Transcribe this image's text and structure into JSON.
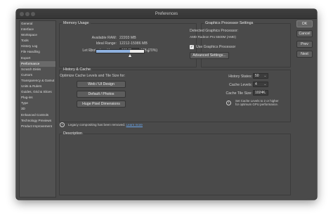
{
  "window": {
    "title": "Preferences"
  },
  "sidebar": {
    "items": [
      {
        "label": "General"
      },
      {
        "label": "Interface"
      },
      {
        "label": "Workspace"
      },
      {
        "label": "Tools"
      },
      {
        "label": "History Log"
      },
      {
        "label": "File Handling"
      },
      {
        "label": "Export"
      },
      {
        "label": "Performance"
      },
      {
        "label": "Scratch Disks"
      },
      {
        "label": "Cursors"
      },
      {
        "label": "Transparency & Gamut"
      },
      {
        "label": "Units & Rulers"
      },
      {
        "label": "Guides, Grid & Slices"
      },
      {
        "label": "Plug-ins"
      },
      {
        "label": "Type"
      },
      {
        "label": "3D"
      },
      {
        "label": "Enhanced Controls"
      },
      {
        "label": "Technology Previews"
      },
      {
        "label": "Product Improvement"
      }
    ],
    "active": "Performance"
  },
  "memory": {
    "title": "Memory Usage",
    "available_label": "Available RAM:",
    "available_value": "22203 MB",
    "ideal_label": "Ideal Range:",
    "ideal_value": "12212-15986 MB",
    "let_label": "Let Photoshop Use:",
    "let_value": "15542",
    "let_unit": "MB (70%)",
    "slider_percent": 70,
    "minus": "−",
    "plus": "+"
  },
  "gpu": {
    "title": "Graphics Processor Settings",
    "detected_label": "Detected Graphics Processor:",
    "detected_value": "AMD Radeon Pro 5500M (AMD)",
    "use_label": "Use Graphics Processor",
    "use_checked": true,
    "advanced_button": "Advanced Settings..."
  },
  "buttons": {
    "ok": "OK",
    "cancel": "Cancel",
    "prev": "Prev",
    "next": "Next"
  },
  "history_cache": {
    "title": "History & Cache",
    "optimize_label": "Optimize Cache Levels and Tile Size for:",
    "web_button": "Web / UI Design",
    "default_button": "Default / Photos",
    "huge_button": "Huge Pixel Dimensions",
    "history_states_label": "History States:",
    "history_states_value": "50",
    "cache_levels_label": "Cache Levels:",
    "cache_levels_value": "4",
    "tile_size_label": "Cache Tile Size:",
    "tile_size_value": "1024K",
    "note": "Set Cache Levels to 2 or higher for optimum GPU performance."
  },
  "legacy": {
    "text": "Legacy compositing has been removed.",
    "link": "Learn more"
  },
  "description": {
    "title": "Description"
  }
}
